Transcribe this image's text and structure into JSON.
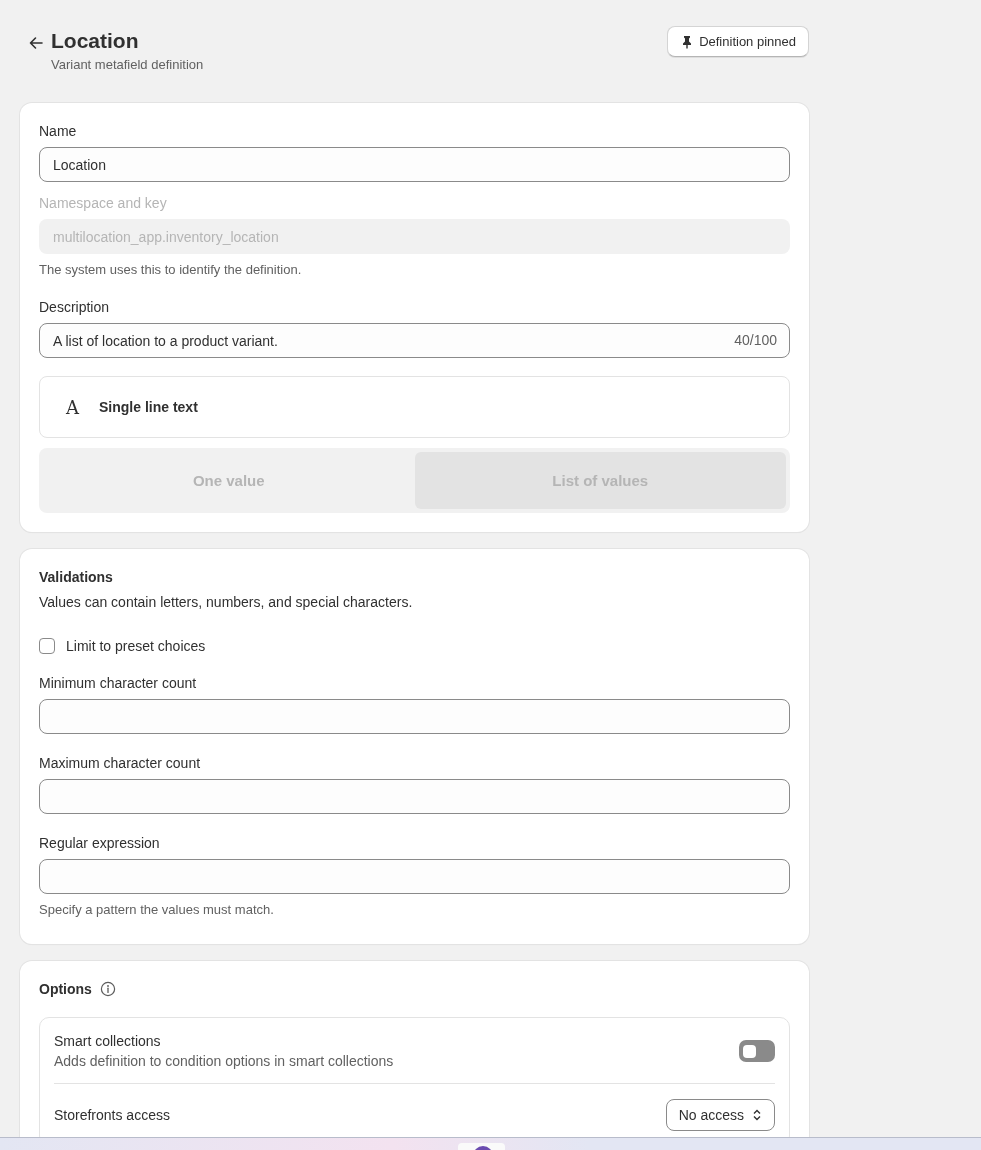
{
  "header": {
    "title": "Location",
    "subtitle": "Variant metafield definition",
    "pin_button": {
      "label": "Definition pinned",
      "pinned": true
    }
  },
  "definition": {
    "name": {
      "label": "Name",
      "value": "Location"
    },
    "namespace": {
      "label": "Namespace and key",
      "value": "multilocation_app.inventory_location",
      "disabled": true,
      "help": "The system uses this to identify the definition."
    },
    "description": {
      "label": "Description",
      "value": "A list of location to a product variant.",
      "counter": "40/100"
    },
    "type": {
      "glyph": "A",
      "label": "Single line text"
    },
    "cardinality": {
      "disabled": true,
      "options": [
        {
          "label": "One value",
          "selected": false
        },
        {
          "label": "List of values",
          "selected": true
        }
      ]
    }
  },
  "validations": {
    "title": "Validations",
    "description": "Values can contain letters, numbers, and special characters.",
    "checkbox": {
      "label": "Limit to preset choices",
      "checked": false
    },
    "fields": [
      {
        "label": "Minimum character count"
      },
      {
        "label": "Maximum character count"
      },
      {
        "label": "Regular expression",
        "help": "Specify a pattern the values must match."
      }
    ]
  },
  "options": {
    "title": "Options",
    "items": [
      {
        "kind": "toggle",
        "title": "Smart collections",
        "description": "Adds definition to condition options in smart collections",
        "on": false
      },
      {
        "kind": "select",
        "title": "Storefronts access",
        "value": "No access"
      }
    ]
  }
}
